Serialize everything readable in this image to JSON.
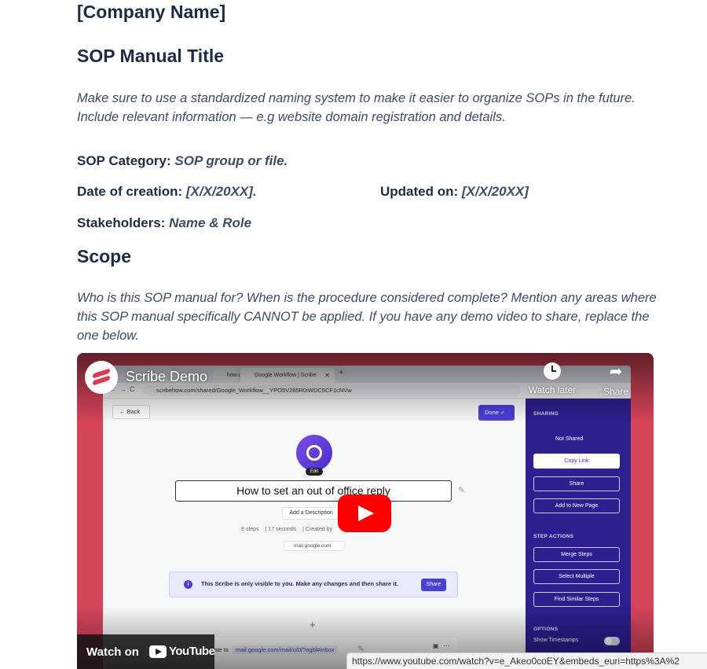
{
  "document": {
    "company_name": "[Company Name]",
    "sop_title": "SOP Manual Title",
    "intro_text": "Make sure to use a standardized naming system to make it easier to organize SOPs in the future. Include relevant information — e.g website domain registration and details.",
    "category_label": "SOP Category:",
    "category_value": "SOP group or file.",
    "date_label": "Date of creation:",
    "date_value": "[X/X/20XX].",
    "updated_label": "Updated on:",
    "updated_value": "[X/X/20XX]",
    "stakeholders_label": "Stakeholders:",
    "stakeholders_value": "Name & Role",
    "scope_heading": "Scope",
    "scope_text": "Who is this SOP manual for? When is the procedure considered complete? Mention any areas where this SOP manual specifically CANNOT be applied. If you have any demo video to share, replace the one below."
  },
  "video": {
    "title": "Scribe Demo",
    "watch_later_label": "Watch later",
    "share_label": "Share",
    "watch_on_label": "Watch on",
    "youtube_label": "YouTube",
    "colors": {
      "background": "#d6445a",
      "play_button": "#ff0000",
      "panel": "#2c1f8f",
      "accent": "#4b3fd6"
    },
    "inner": {
      "tab1": "how.co",
      "tab2": "Google Workflow | Scribe",
      "url": "scribehow.com/shared/Google_Workflow__YPO5V285R0iWDC5CF1cNVw",
      "back_label": "Back",
      "done_label": "Done",
      "edit_label": "Edit",
      "scribe_title": "How to set an out of office reply",
      "add_description": "Add a Description",
      "steps_count": "8 steps",
      "duration": "17 seconds",
      "created_by": "Created by",
      "domain_chip": "mail.google.com",
      "notice_text": "This Scribe is only visible to you. Make any changes and then share it.",
      "notice_share": "Share",
      "step_text": "Navigate to",
      "step_link": "mail.google.com/mail/u/0/?ogbl#inbox",
      "sharing_header": "SHARING",
      "not_shared": "Not Shared",
      "copy_link": "Copy Link",
      "share_btn": "Share",
      "add_to_page": "Add to New Page",
      "step_actions_header": "STEP ACTIONS",
      "merge_steps": "Merge Steps",
      "select_multiple": "Select Multiple",
      "find_similar": "Find Similar Steps",
      "options_header": "OPTIONS",
      "show_timestamps": "Show Timestamps"
    }
  },
  "status_bar": {
    "url": "https://www.youtube.com/watch?v=e_Akeo0coEY&embeds_euri=https%3A%2"
  }
}
